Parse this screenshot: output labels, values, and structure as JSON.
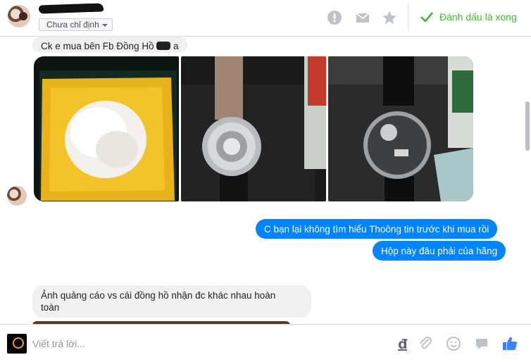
{
  "header": {
    "tag_label": "Chưa chỉ định",
    "done_label": "Đánh dấu là xong",
    "icons": [
      "avatar",
      "name-scribble",
      "alert-icon",
      "mail-icon",
      "star-icon",
      "check-icon"
    ]
  },
  "messages": [
    {
      "direction": "in",
      "text": "Ck e mua bên Fb Đồng Hồ"
    },
    {
      "direction": "in",
      "text_suffix": "a"
    },
    {
      "direction": "in",
      "type": "photos",
      "count": 3
    },
    {
      "direction": "out",
      "text": "C bạn lại không tìm hiểu Thoông tin trước khi mua rồi"
    },
    {
      "direction": "out",
      "text": "Hộp này đâu phải của hãng"
    },
    {
      "direction": "in",
      "text": "Ảnh quảng cáo vs cái đồng hồ nhận đc khác nhau hoàn toàn"
    }
  ],
  "msg1": {
    "text": "Ck e mua bên Fb Đồng Hồ",
    "suffix": "a"
  },
  "msg2": {
    "text": "C bạn lại không tìm hiểu Thoông tin trước khi mua rồi"
  },
  "msg3": {
    "text": "Hộp này đâu phải của hãng"
  },
  "msg4": {
    "text": "Ảnh quảng cáo vs cái đồng hồ nhận đc khác nhau hoàn toàn"
  },
  "composer": {
    "placeholder": "Viết trả lời...",
    "icons": [
      "currency-dong-icon",
      "paperclip-icon",
      "emoji-icon",
      "sticker-icon",
      "like-icon"
    ]
  },
  "colors": {
    "accent": "#0084ff",
    "done": "#42b72a",
    "incoming_bg": "#f1f0f0"
  }
}
